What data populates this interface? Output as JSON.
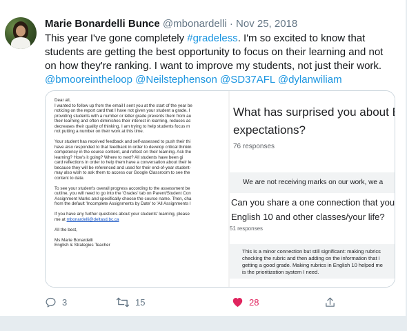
{
  "tweet": {
    "author_name": "Marie Bonardelli Bunce",
    "handle": "@mbonardelli",
    "separator": "·",
    "date": "Nov 25, 2018",
    "text": {
      "line1_pre": "This year I've gone completely ",
      "hashtag": "#gradeless",
      "line1_post": ". I'm so excited to know that",
      "line2": "students are getting the best opportunity to focus on their learning and not",
      "line3": "on how they're ranking. I want to improve my students, not just their work.",
      "mentions": [
        "@bmooreintheloop",
        "@Neilstephenson",
        "@SD37AFL",
        "@dylanwiliam"
      ]
    }
  },
  "letter": {
    "lines": [
      "Dear all,",
      "I wanted to follow up from the email I sent you at the start of the year be",
      "noticing on the report card that I have not given your student a grade. I",
      "providing students with a number or letter grade prevents them from au",
      "their learning and often diminishes their interest in learning, reduces ac",
      "decreases their quality of thinking. I am trying to help students focus m",
      "not putting a number on their work at this time.",
      "",
      "Your student has received feedback and self-assessed to push their thi",
      "have also responded to that feedback in order to develop critical thinkin",
      "competency in the course content, and reflect on their learning. Ask the",
      "learning? How's it going? Where to next?  All students have been gi",
      "card reflections in order to help them have a conversation about their le",
      "because they will be referenced and used for their end-of-year student-",
      "may also wish to ask them to access our Google Classroom to see the",
      "content to date.",
      "",
      "To see your student's overall progress according to the assessment be",
      "outline, you will need to go into the 'Grades' tab on Parent/Student Con",
      "Assignment Marks and specifically choose the course name. Then, cha",
      "from the default 'Incomplete Assignments by Date' to 'All Assignments I",
      "",
      "If you have any further questions about your students' learning, please",
      "me at ",
      "",
      "All the best,",
      "",
      "Ms Marie Bonardelli",
      "English & Strategies Teacher"
    ],
    "email": "mbonardelli@deltasd.bc.ca"
  },
  "survey": {
    "question1_line1": "What has surprised you about E",
    "question1_line2": "expectations?",
    "responses1": "76 responses",
    "response1": "We are not receiving marks on our work, we a",
    "question2_line1": "Can you share a one connection that you",
    "question2_line2": "English 10 and other classes/your life?",
    "responses2": "51 responses",
    "response2_lines": [
      "This is a minor connection but still significant: making rubrics",
      "checking the rubric and then adding on the information that I",
      "getting a good grade. Making rubrics in English 10 helped me",
      "is the prioritization system I need."
    ]
  },
  "actions": {
    "reply_count": "3",
    "retweet_count": "15",
    "like_count": "28",
    "icons": [
      "reply-icon",
      "retweet-icon",
      "heart-icon",
      "share-icon"
    ]
  },
  "colors": {
    "link": "#1b95e0",
    "like": "#e0245e",
    "muted": "#657786",
    "text": "#14171a"
  }
}
